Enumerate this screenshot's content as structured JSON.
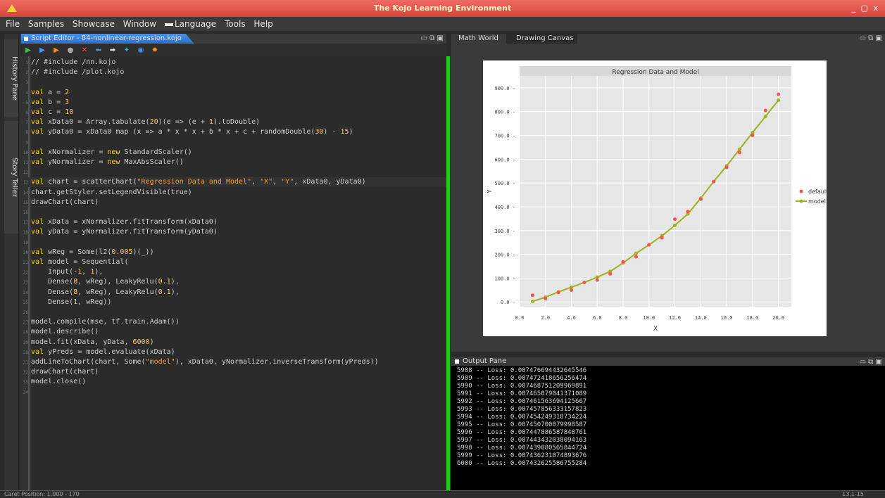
{
  "window": {
    "title": "The Kojo Learning Environment",
    "controls": "_ ▢ x"
  },
  "menu": [
    "File",
    "Samples",
    "Showcase",
    "Window",
    "Language",
    "Tools",
    "Help"
  ],
  "side_tabs": {
    "history": "History Pane",
    "story": "Story Teller"
  },
  "editor": {
    "tab_label": "Script Editor - 84-nonlinear-regression.kojo",
    "panel_controls": "▭ ⧉ ▣",
    "toolbar_icons": [
      "run-icon",
      "run-worksheet-icon",
      "trace-icon",
      "stop-icon",
      "clear-icon",
      "undo-icon",
      "redo-icon",
      "format-icon",
      "globe-icon",
      "replay-icon"
    ],
    "lines": [
      {
        "n": "1",
        "text": "// #include /nn.kojo"
      },
      {
        "n": "2",
        "text": "// #include /plot.kojo"
      },
      {
        "n": "3",
        "text": ""
      },
      {
        "n": "4",
        "text": "val a = 2"
      },
      {
        "n": "5",
        "text": "val b = 3"
      },
      {
        "n": "6",
        "text": "val c = 10"
      },
      {
        "n": "7",
        "text": "val xData0 = Array.tabulate(20)(e => (e + 1).toDouble)"
      },
      {
        "n": "8",
        "text": "val yData0 = xData0 map (x => a * x * x + b * x + c + randomDouble(30) - 15)"
      },
      {
        "n": "9",
        "text": ""
      },
      {
        "n": "10",
        "text": "val xNormalizer = new StandardScaler()"
      },
      {
        "n": "11",
        "text": "val yNormalizer = new MaxAbsScaler()"
      },
      {
        "n": "12",
        "text": ""
      },
      {
        "n": "13",
        "text": "val chart = scatterChart(\"Regression Data and Model\", \"X\", \"Y\", xData0, yData0)"
      },
      {
        "n": "14",
        "text": "chart.getStyler.setLegendVisible(true)"
      },
      {
        "n": "15",
        "text": "drawChart(chart)"
      },
      {
        "n": "16",
        "text": ""
      },
      {
        "n": "17",
        "text": "val xData = xNormalizer.fitTransform(xData0)"
      },
      {
        "n": "18",
        "text": "val yData = yNormalizer.fitTransform(yData0)"
      },
      {
        "n": "19",
        "text": ""
      },
      {
        "n": "20",
        "text": "val wReg = Some(l2(0.005)(_))"
      },
      {
        "n": "21",
        "text": "val model = Sequential("
      },
      {
        "n": "22",
        "text": "    Input(-1, 1),"
      },
      {
        "n": "23",
        "text": "    Dense(8, wReg), LeakyRelu(0.1),"
      },
      {
        "n": "24",
        "text": "    Dense(8, wReg), LeakyRelu(0.1),"
      },
      {
        "n": "25",
        "text": "    Dense(1, wReg))"
      },
      {
        "n": "26",
        "text": ""
      },
      {
        "n": "27",
        "text": "model.compile(mse, tf.train.Adam())"
      },
      {
        "n": "28",
        "text": "model.describe()"
      },
      {
        "n": "29",
        "text": "model.fit(xData, yData, 6000)"
      },
      {
        "n": "30",
        "text": "val yPreds = model.evaluate(xData)"
      },
      {
        "n": "31",
        "text": "addLineToChart(chart, Some(\"model\"), xData0, yNormalizer.inverseTransform(yPreds))"
      },
      {
        "n": "32",
        "text": "drawChart(chart)"
      },
      {
        "n": "33",
        "text": "model.close()"
      },
      {
        "n": "34",
        "text": ""
      }
    ]
  },
  "right_tabs": [
    "Math World",
    "Drawing Canvas"
  ],
  "chart_data": {
    "type": "scatter",
    "title": "Regression Data and Model",
    "xlabel": "X",
    "ylabel": "Y",
    "xlim": [
      0,
      21
    ],
    "ylim": [
      -20,
      950
    ],
    "x_ticks": [
      "0.0",
      "2.0",
      "4.0",
      "6.0",
      "8.0",
      "10.0",
      "12.0",
      "14.0",
      "16.0",
      "18.0",
      "20.0"
    ],
    "y_ticks": [
      "0.0",
      "100.0",
      "200.0",
      "300.0",
      "400.0",
      "500.0",
      "600.0",
      "700.0",
      "800.0",
      "900.0"
    ],
    "series": [
      {
        "name": "default",
        "kind": "scatter",
        "color": "#ff5050",
        "x": [
          1,
          2,
          3,
          4,
          5,
          6,
          7,
          8,
          9,
          10,
          11,
          12,
          13,
          14,
          15,
          16,
          17,
          18,
          19,
          20
        ],
        "y": [
          28,
          14,
          40,
          50,
          82,
          92,
          118,
          168,
          190,
          240,
          270,
          348,
          380,
          432,
          506,
          566,
          628,
          700,
          805,
          873
        ]
      },
      {
        "name": "model",
        "kind": "line",
        "color": "#a0b020",
        "x": [
          1,
          2,
          3,
          4,
          5,
          6,
          7,
          8,
          9,
          10,
          11,
          12,
          13,
          14,
          15,
          16,
          17,
          18,
          19,
          20
        ],
        "y": [
          2,
          20,
          42,
          62,
          82,
          104,
          128,
          164,
          204,
          240,
          278,
          322,
          370,
          436,
          506,
          572,
          642,
          712,
          780,
          848
        ]
      }
    ],
    "legend_position": "right"
  },
  "output": {
    "title": "Output Pane",
    "lines": [
      "5988 -- Loss: 0.007476694432645546",
      "5989 -- Loss: 0.007472418656256474",
      "5990 -- Loss: 0.007468751209969891",
      "5991 -- Loss: 0.007465079041371089",
      "5992 -- Loss: 0.007461563694125667",
      "5993 -- Loss: 0.007457856333157823",
      "5994 -- Loss: 0.007454249318734224",
      "5995 -- Loss: 0.007450700079998587",
      "5996 -- Loss: 0.007447886587848761",
      "5997 -- Loss: 0.007443432038094163",
      "5998 -- Loss: 0.007439880565844724",
      "5999 -- Loss: 0.007436231074893676",
      "6000 -- Loss: 0.007432625586755284"
    ]
  },
  "status": {
    "left": "Caret Position: 1,000 - 170",
    "right": "13,1-15"
  }
}
